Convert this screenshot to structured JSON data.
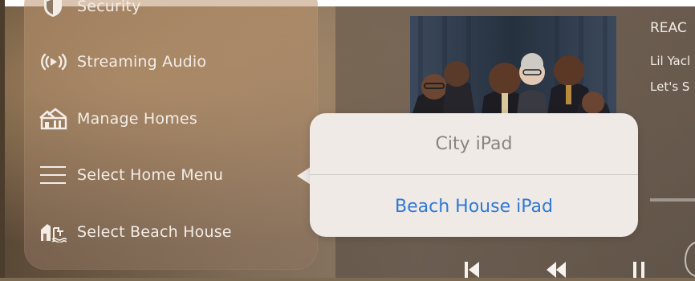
{
  "menu": {
    "items": [
      {
        "label": "Security",
        "icon": "shield-icon"
      },
      {
        "label": "Streaming Audio",
        "icon": "streaming-audio-icon"
      },
      {
        "label": "Manage Homes",
        "icon": "homes-icon"
      },
      {
        "label": "Select Home Menu",
        "icon": "hamburger-menu-icon"
      },
      {
        "label": "Select Beach House",
        "icon": "beach-house-icon"
      }
    ]
  },
  "now_playing": {
    "title_partial": "REAC",
    "artist_partial": "Lil Yacl",
    "album_partial": "Let's S"
  },
  "popover": {
    "options": [
      "City iPad",
      "Beach House iPad"
    ],
    "selected": "Beach House iPad"
  },
  "transport": {
    "icons": [
      "skip-back-icon",
      "rewind-icon",
      "pause-icon"
    ]
  },
  "colors": {
    "accent_blue": "#2f78d6",
    "popover_bg": "#efeae5",
    "menu_text": "#f3ede6",
    "muted_option": "#8a8582"
  }
}
